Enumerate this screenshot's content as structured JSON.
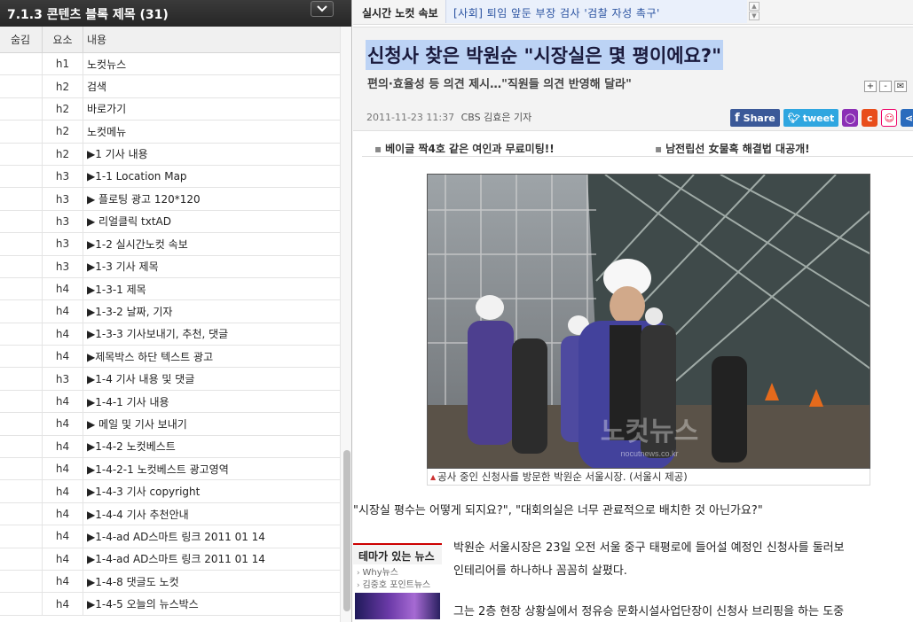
{
  "left_panel": {
    "title": "7.1.3 콘텐츠 블록 제목 (31)",
    "collapse_icon": "chevron-down-icon",
    "columns": {
      "hidden": "숨김",
      "element": "요소",
      "content": "내용"
    },
    "rows": [
      {
        "tag": "h1",
        "text": "노컷뉴스"
      },
      {
        "tag": "h2",
        "text": "검색"
      },
      {
        "tag": "h2",
        "text": "바로가기"
      },
      {
        "tag": "h2",
        "text": "노컷메뉴"
      },
      {
        "tag": "h2",
        "text": "▶1 기사 내용"
      },
      {
        "tag": "h3",
        "text": "▶1-1 Location Map"
      },
      {
        "tag": "h3",
        "text": "▶ 플로팅 광고 120*120"
      },
      {
        "tag": "h3",
        "text": "▶ 리얼클릭 txtAD"
      },
      {
        "tag": "h3",
        "text": "▶1-2 실시간노컷 속보"
      },
      {
        "tag": "h3",
        "text": "▶1-3 기사 제목"
      },
      {
        "tag": "h4",
        "text": "▶1-3-1 제목"
      },
      {
        "tag": "h4",
        "text": "▶1-3-2 날짜, 기자"
      },
      {
        "tag": "h4",
        "text": "▶1-3-3 기사보내기, 추천, 댓글"
      },
      {
        "tag": "h4",
        "text": "▶제목박스 하단 텍스트 광고"
      },
      {
        "tag": "h3",
        "text": "▶1-4 기사 내용 및 댓글"
      },
      {
        "tag": "h4",
        "text": "▶1-4-1 기사 내용"
      },
      {
        "tag": "h4",
        "text": "▶ 메일 및 기사 보내기"
      },
      {
        "tag": "h4",
        "text": "▶1-4-2 노컷베스트"
      },
      {
        "tag": "h4",
        "text": "▶1-4-2-1 노컷베스트 광고영역"
      },
      {
        "tag": "h4",
        "text": "▶1-4-3 기사 copyright"
      },
      {
        "tag": "h4",
        "text": "▶1-4-4 기사 추천안내"
      },
      {
        "tag": "h4",
        "text": "▶1-4-ad AD스마트 링크 2011 01 14"
      },
      {
        "tag": "h4",
        "text": "▶1-4-ad AD스마트 링크 2011 01 14"
      },
      {
        "tag": "h4",
        "text": "▶1-4-8 댓글도 노컷"
      },
      {
        "tag": "h4",
        "text": "▶1-4-5 오늘의 뉴스박스"
      }
    ]
  },
  "article": {
    "ticker": {
      "label": "실시간 노컷 속보",
      "text": "[사회] 퇴임 앞둔 부장 검사 '검찰 자성 촉구'",
      "up_icon": "arrow-up-icon",
      "down_icon": "arrow-down-icon"
    },
    "headline": "신청사 찾은 박원순 \"시장실은 몇 평이에요?\"",
    "subheadline": "편의·효율성 등 의견 제시…\"직원들 의견 반영해 달라\"",
    "tools": [
      "+",
      "-",
      "✉"
    ],
    "date": "2011-11-23 11:37",
    "byline": "CBS 김효은 기자",
    "share": {
      "facebook": "Share",
      "twitter": "tweet"
    },
    "ads": [
      "베이글 짝4호 같은 여인과 무료미팅!!",
      "남전립선 女물혹 해결법 대공개!"
    ],
    "photo_watermark": "노컷뉴스",
    "photo_watermark_sub": "nocutnews.co.kr",
    "caption": "공사 중인 신청사를 방문한 박원순 서울시장. (서울시 제공)",
    "quote": "\"시장실 평수는 어떻게 되지요?\", \"대회의실은 너무 관료적으로 배치한 것 아닌가요?\"",
    "paragraphs": [
      "박원순 서울시장은 23일 오전 서울 중구 태평로에 들어설 예정인 신청사를 둘러보",
      "인테리어를 하나하나 꼼꼼히 살폈다.",
      "그는 2층 현장 상황실에서 정유승 문화시설사업단장이 신청사 브리핑을 하는 도중"
    ],
    "theme_box": {
      "title": "테마가 있는 뉴스",
      "items": [
        "Why뉴스",
        "김중호 포인트뉴스"
      ]
    }
  },
  "colors": {
    "header_dark": "#2e2e2e",
    "headline_highlight": "#bcd3f5",
    "ticker_link": "#2a52a0",
    "facebook": "#3b5998",
    "twitter": "#2fa6e0"
  }
}
